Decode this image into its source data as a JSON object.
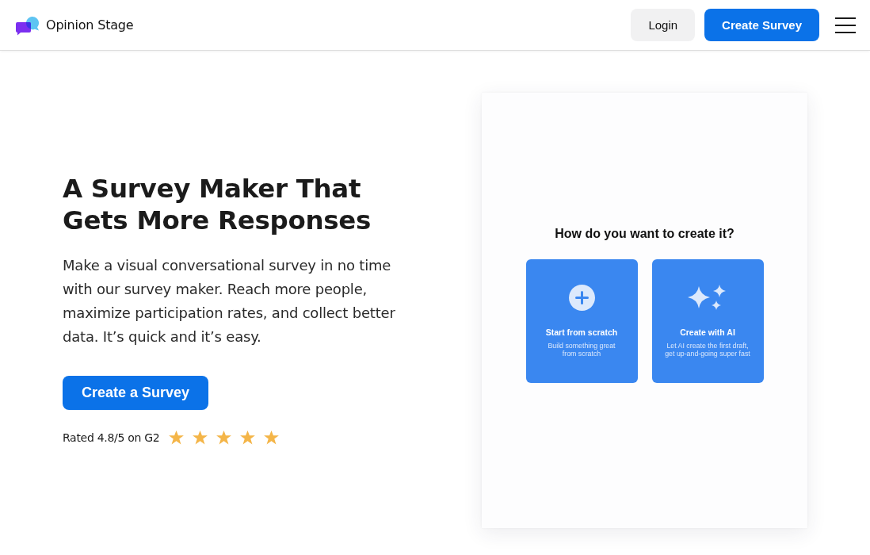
{
  "header": {
    "brand": "Opinion Stage",
    "buttons": [
      {
        "label": "Login",
        "kind": "secondary"
      },
      {
        "label": "Create Survey",
        "kind": "primary"
      }
    ]
  },
  "hero": {
    "title": "A Survey Maker That Gets More Responses",
    "description": "Make a visual conversational survey in no time with our survey maker. Reach more people, maximize participation rates, and collect better data. It’s quick and it’s easy.",
    "cta": "Create a Survey",
    "rating": {
      "text": "Rated 4.8/5 on G2",
      "stars": 5
    }
  },
  "preview": {
    "question": "How do you want to create it?",
    "options": [
      {
        "kind": "scratch",
        "title": "Start from scratch",
        "subtitle": "Build something great\nfrom scratch"
      },
      {
        "kind": "ai",
        "title": "Create with AI",
        "subtitle": "Let AI create the first draft,\nget up-and-going super fast"
      }
    ]
  }
}
